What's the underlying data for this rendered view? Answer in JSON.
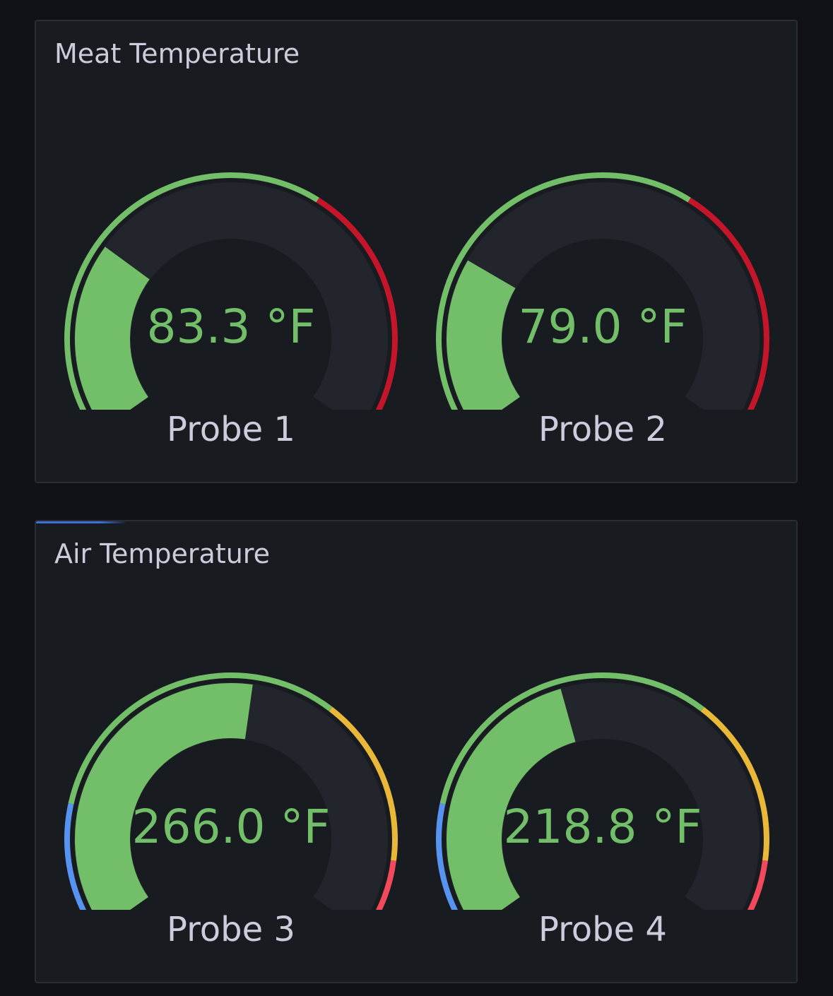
{
  "panels": [
    {
      "title": "Meat Temperature",
      "gauges": [
        {
          "label": "Probe 1",
          "display": "83.3 °F",
          "value": 83.3
        },
        {
          "label": "Probe 2",
          "display": "79.0 °F",
          "value": 79.0
        }
      ],
      "min": 32,
      "max": 212,
      "thresholds": [
        {
          "from": 32,
          "to": 145,
          "color": "#73bf69"
        },
        {
          "from": 145,
          "to": 212,
          "color": "#c4162a"
        }
      ]
    },
    {
      "title": "Air Temperature",
      "gauges": [
        {
          "label": "Probe 3",
          "display": "266.0 °F",
          "value": 266.0
        },
        {
          "label": "Probe 4",
          "display": "218.8 °F",
          "value": 218.8
        }
      ],
      "min": 0,
      "max": 500,
      "thresholds": [
        {
          "from": 0,
          "to": 95,
          "color": "#5794f2"
        },
        {
          "from": 95,
          "to": 325,
          "color": "#73bf69"
        },
        {
          "from": 325,
          "to": 445,
          "color": "#eab839"
        },
        {
          "from": 445,
          "to": 500,
          "color": "#f2495c"
        }
      ]
    }
  ],
  "colors": {
    "value": "#73bf69",
    "track": "#22252b",
    "background": "#181b1f"
  }
}
